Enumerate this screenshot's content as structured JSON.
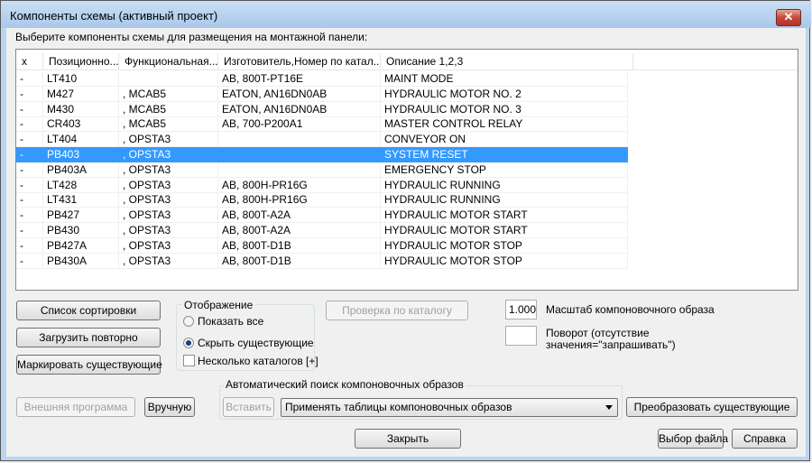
{
  "window": {
    "title": "Компоненты схемы (активный проект)",
    "close_glyph": "✕"
  },
  "prompt": "Выберите компоненты схемы для размещения на монтажной панели:",
  "table": {
    "columns": [
      "x",
      "Позиционно...",
      "Функциональная...",
      "Изготовитель,Номер по катал...",
      "Описание 1,2,3"
    ],
    "rows": [
      {
        "x": "-",
        "tag": "LT410",
        "func": "",
        "mfg": "AB, 800T-PT16E",
        "desc": "MAINT MODE",
        "selected": false
      },
      {
        "x": "-",
        "tag": "M427",
        "func": ", MCAB5",
        "mfg": "EATON, AN16DN0AB",
        "desc": "HYDRAULIC MOTOR NO. 2",
        "selected": false
      },
      {
        "x": "-",
        "tag": "M430",
        "func": ", MCAB5",
        "mfg": "EATON, AN16DN0AB",
        "desc": "HYDRAULIC MOTOR NO. 3",
        "selected": false
      },
      {
        "x": "-",
        "tag": "CR403",
        "func": ", MCAB5",
        "mfg": "AB, 700-P200A1",
        "desc": "MASTER CONTROL RELAY",
        "selected": false
      },
      {
        "x": "-",
        "tag": "LT404",
        "func": ", OPSTA3",
        "mfg": "",
        "desc": "CONVEYOR ON",
        "selected": false
      },
      {
        "x": "-",
        "tag": "PB403",
        "func": ", OPSTA3",
        "mfg": "",
        "desc": "SYSTEM RESET",
        "selected": true
      },
      {
        "x": "-",
        "tag": "PB403A",
        "func": ", OPSTA3",
        "mfg": "",
        "desc": "EMERGENCY STOP",
        "selected": false
      },
      {
        "x": "-",
        "tag": "LT428",
        "func": ", OPSTA3",
        "mfg": "AB, 800H-PR16G",
        "desc": "HYDRAULIC RUNNING",
        "selected": false
      },
      {
        "x": "-",
        "tag": "LT431",
        "func": ", OPSTA3",
        "mfg": "AB, 800H-PR16G",
        "desc": "HYDRAULIC RUNNING",
        "selected": false
      },
      {
        "x": "-",
        "tag": "PB427",
        "func": ", OPSTA3",
        "mfg": "AB, 800T-A2A",
        "desc": "HYDRAULIC MOTOR START",
        "selected": false
      },
      {
        "x": "-",
        "tag": "PB430",
        "func": ", OPSTA3",
        "mfg": "AB, 800T-A2A",
        "desc": "HYDRAULIC MOTOR START",
        "selected": false
      },
      {
        "x": "-",
        "tag": "PB427A",
        "func": ", OPSTA3",
        "mfg": "AB, 800T-D1B",
        "desc": "HYDRAULIC MOTOR STOP",
        "selected": false
      },
      {
        "x": "-",
        "tag": "PB430A",
        "func": ", OPSTA3",
        "mfg": "AB, 800T-D1B",
        "desc": "HYDRAULIC MOTOR STOP",
        "selected": false
      }
    ]
  },
  "buttons": {
    "sort_list": "Список сортировки",
    "reload": "Загрузить повторно",
    "mark_existing": "Маркировать существующие",
    "external_program": "Внешняя программа",
    "manual": "Вручную",
    "catalog_check": "Проверка по каталогу",
    "insert": "Вставить",
    "convert_existing": "Преобразовать существующие",
    "close": "Закрыть",
    "select_file": "Выбор файла",
    "help": "Справка"
  },
  "display_group": {
    "legend": "Отображение",
    "show_all": "Показать все",
    "hide_existing": "Скрыть существующие",
    "multiple_catalogs": "Несколько каталогов [+]",
    "selected_option": "hide_existing",
    "multiple_catalogs_checked": false
  },
  "scale": {
    "value": "1.000",
    "label": "Масштаб компоновочного образа"
  },
  "rotation": {
    "value": "",
    "label_line1": "Поворот (отсутствие",
    "label_line2": "значения=\"запрашивать\")"
  },
  "auto_search": {
    "legend": "Автоматический поиск компоновочных образов",
    "combo_value": "Применять таблицы компоновочных образов"
  }
}
